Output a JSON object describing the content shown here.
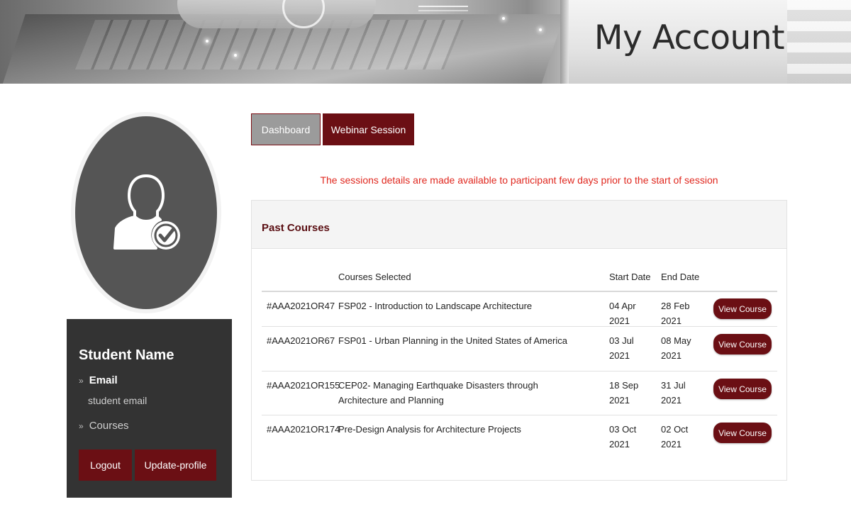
{
  "banner": {
    "title": "My Account"
  },
  "profile": {
    "name": "Student Name",
    "email_label": "Email",
    "email_value": "student email",
    "courses_label": "Courses",
    "logout_label": "Logout",
    "update_label": "Update-profile"
  },
  "tabs": [
    {
      "label": "Dashboard"
    },
    {
      "label": "Webinar Session"
    }
  ],
  "notice": "The sessions details are made available to participant few days prior to the start of session",
  "past_courses": {
    "title": "Past Courses",
    "headers": {
      "code": "",
      "course": "Courses Selected",
      "start": "Start Date",
      "end": "End Date"
    },
    "view_label": "View Course",
    "rows": [
      {
        "code": "#AAA2021OR47",
        "course": "FSP02 - Introduction to Landscape Architecture",
        "start": "04 Apr 2021",
        "end": "28 Feb 2021"
      },
      {
        "code": "#AAA2021OR67",
        "course": "FSP01 - Urban Planning in the United States of America",
        "start": "03 Jul 2021",
        "end": "08 May 2021"
      },
      {
        "code": "#AAA2021OR155",
        "course": "CEP02- Managing Earthquake Disasters through Architecture and Planning",
        "start": "18 Sep 2021",
        "end": "31 Jul 2021"
      },
      {
        "code": "#AAA2021OR174",
        "course": "Pre-Design Analysis for Architecture Projects",
        "start": "03 Oct 2021",
        "end": "02 Oct 2021"
      }
    ]
  },
  "colors": {
    "accent": "#6b0f14",
    "notice": "#e0281f",
    "sidebar": "#333333"
  },
  "icons": {
    "avatar": "user-check-icon",
    "bullet": "double-chevron-right-icon"
  }
}
